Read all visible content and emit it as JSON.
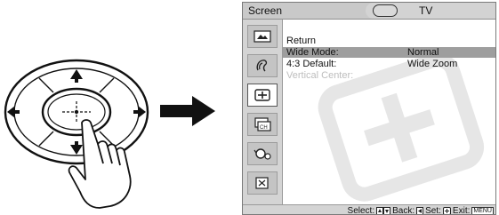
{
  "screen": {
    "title": "Screen",
    "input_label": "TV",
    "menu": [
      {
        "label": "Return",
        "value": ""
      },
      {
        "label": "Wide  Mode:",
        "value": "Normal"
      },
      {
        "label": "4:3  Default:",
        "value": "Wide  Zoom"
      },
      {
        "label": "Vertical  Center:",
        "value": ""
      }
    ],
    "sidebar_icons": [
      "picture-icon",
      "sound-icon",
      "screen-icon",
      "channel-icon",
      "parental-icon",
      "setup-icon"
    ],
    "footer": {
      "select": "Select:",
      "back": "Back:",
      "set": "Set:",
      "exit": "Exit:",
      "menu_key": "MENU"
    }
  },
  "colors": {
    "header_bg": "#c9c9c9",
    "highlight": "#9e9e9e",
    "sidebar_bg": "#d4d4d4",
    "dim_text": "#bdbdbd"
  }
}
